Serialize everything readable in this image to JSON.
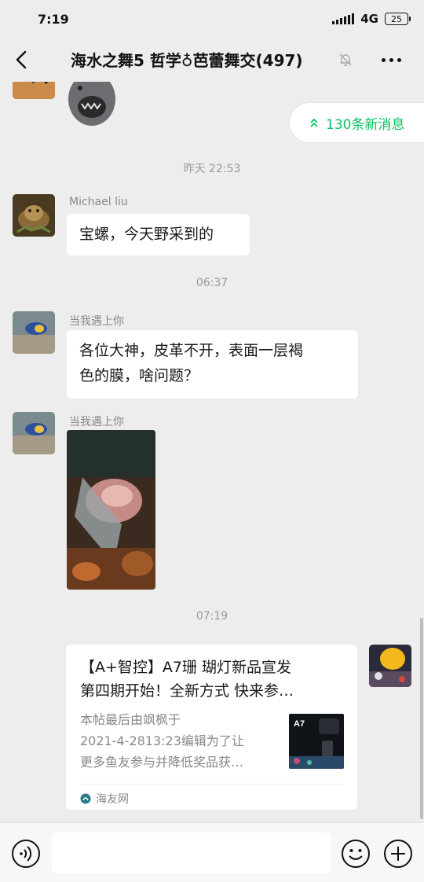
{
  "status_bar": {
    "time": "7:19",
    "network": "4G",
    "battery": "25"
  },
  "nav": {
    "title": "海水之舞5 哲学♁芭蕾舞交(497)"
  },
  "banner": {
    "new_messages": "130条新消息"
  },
  "messages": [
    {
      "type": "time",
      "text": "昨天 22:53"
    },
    {
      "type": "text",
      "sender": "Michael liu",
      "text": "宝螺，今天野采到的"
    },
    {
      "type": "time",
      "text": "06:37"
    },
    {
      "type": "text",
      "sender": "当我遇上你",
      "lines": [
        "各位大神，皮革不开，表面一层褐",
        "色的膜，啥问题？"
      ]
    },
    {
      "type": "image",
      "sender": "当我遇上你"
    },
    {
      "type": "time",
      "text": "07:19"
    }
  ],
  "link_card": {
    "title_lines": [
      "【A+智控】A7珊 瑚灯新品宣发",
      "第四期开始！全新方式  快来参…"
    ],
    "desc_lines": [
      "本帖最后由飒枫于",
      "2021-4-2813:23编辑为了让",
      "更多鱼友参与并降低奖品获…"
    ],
    "thumb_label": "A7",
    "source": "海友网"
  },
  "colors": {
    "accent_green": "#07c160",
    "background": "#ededed"
  },
  "icons": {
    "back": "chevron-left-icon",
    "mute": "bell-off-icon",
    "more": "more-dots-icon",
    "voice": "voice-icon",
    "emoji": "emoji-icon",
    "plus": "plus-icon"
  }
}
